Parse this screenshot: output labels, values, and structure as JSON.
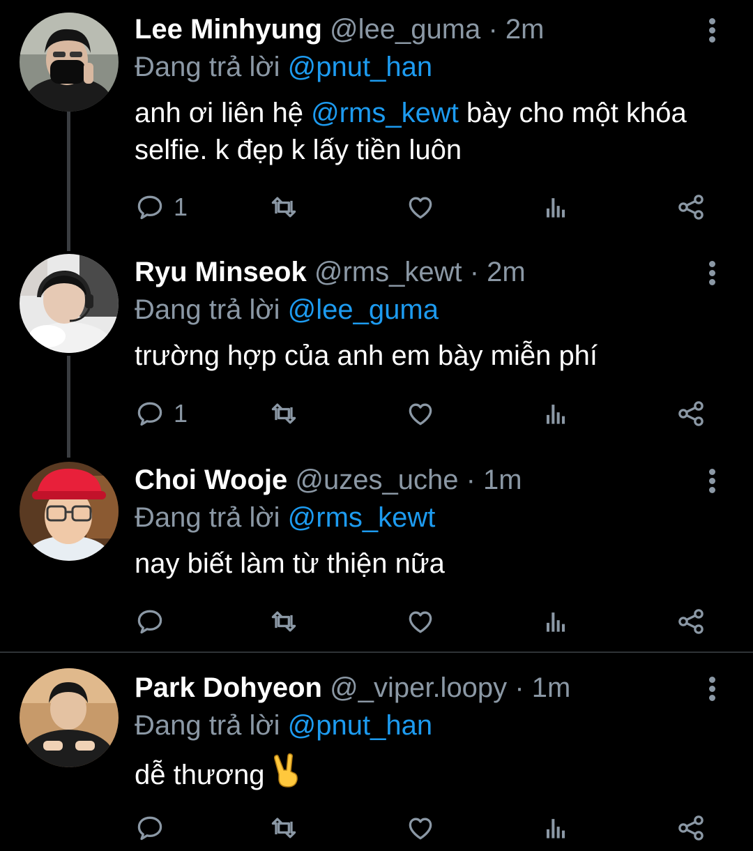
{
  "reply_prefix": "Đang trả lời",
  "tweets": [
    {
      "name": "Lee Minhyung",
      "handle": "@lee_guma",
      "separator": "·",
      "time": "2m",
      "reply_to": "@pnut_han",
      "text_before": "anh ơi liên hệ ",
      "text_mention": "@rms_kewt",
      "text_after": " bày cho một khóa selfie. k đẹp k lấy tiền luôn",
      "reply_count": "1"
    },
    {
      "name": "Ryu Minseok",
      "handle": "@rms_kewt",
      "separator": "·",
      "time": "2m",
      "reply_to": "@lee_guma",
      "text": "trường hợp của anh em bày miễn phí",
      "reply_count": "1"
    },
    {
      "name": "Choi Wooje",
      "handle": "@uzes_uche",
      "separator": "·",
      "time": "1m",
      "reply_to": "@rms_kewt",
      "text": "nay biết làm từ thiện nữa",
      "reply_count": ""
    },
    {
      "name": "Park Dohyeon",
      "handle": "@_viper.loopy",
      "separator": "·",
      "time": "1m",
      "reply_to": "@pnut_han",
      "text": "dễ thương",
      "reply_count": ""
    }
  ],
  "colors": {
    "background": "#000000",
    "text": "#ffffff",
    "muted": "#8b98a5",
    "mention": "#1d9bf0",
    "thread_line": "#3a3d41"
  },
  "icons": [
    "reply-icon",
    "retweet-icon",
    "like-icon",
    "analytics-icon",
    "share-icon",
    "more-icon",
    "victory-hand-emoji"
  ]
}
